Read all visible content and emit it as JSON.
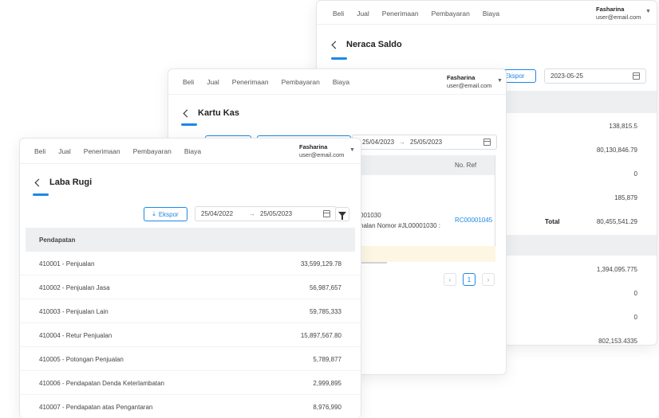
{
  "nav": [
    "Beli",
    "Jual",
    "Penerimaan",
    "Pembayaran",
    "Biaya"
  ],
  "user": {
    "name": "Fasharina",
    "email": "user@email.com"
  },
  "neraca": {
    "title": "Neraca Saldo",
    "ekspor": "Ekspor",
    "date": "2023-05-25",
    "values_a": [
      "138,815.5",
      "80,130,846.79",
      "0",
      "185,879"
    ],
    "total_label": "Total",
    "total_value": "80,455,541.29",
    "values_b": [
      "1,394,095.775",
      "0",
      "0",
      "802,153.4335"
    ]
  },
  "kartu": {
    "title": "Kartu Kas",
    "date_from": "25/04/2023",
    "date_to": "25/05/2023",
    "col_noref": "No. Ref",
    "entry_line1": "001030",
    "entry_line2": "nalan Nomor #JL00001030 :",
    "ref": "RC00001045",
    "page": "1",
    "prev": "‹",
    "next": "›"
  },
  "laba": {
    "title": "Laba Rugi",
    "ekspor": "Ekspor",
    "date_from": "25/04/2022",
    "date_to": "25/05/2023",
    "section": "Pendapatan",
    "rows": [
      {
        "label": "410001 - Penjualan",
        "value": "33,599,129.78"
      },
      {
        "label": "410002 - Penjualan Jasa",
        "value": "56,987,657"
      },
      {
        "label": "410003 - Penjualan Lain",
        "value": "59,785,333"
      },
      {
        "label": "410004 - Retur Penjualan",
        "value": "15,897,567.80"
      },
      {
        "label": "410005 - Potongan Penjualan",
        "value": "5,789,877"
      },
      {
        "label": "410006 - Pendapatan Denda Keterlambatan",
        "value": "2,999,895"
      },
      {
        "label": "410007 - Pendapatan atas Pengantaran",
        "value": "8,976,990"
      }
    ]
  },
  "icons": {
    "back": "chevron-left-icon",
    "download": "download-icon",
    "calendar": "calendar-icon",
    "filter": "filter-icon",
    "dropdown": "caret-down-icon"
  },
  "colors": {
    "accent": "#1e88e5",
    "header_bg": "#eeeff1",
    "highlight": "#fdf6e3"
  }
}
